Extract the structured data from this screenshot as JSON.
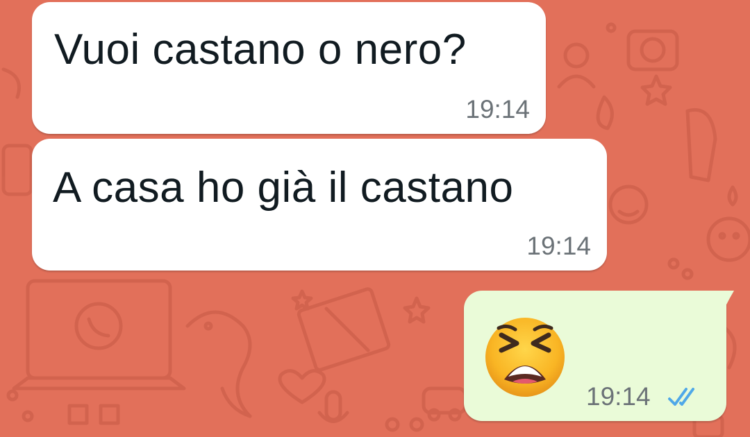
{
  "chat": {
    "messages": [
      {
        "direction": "incoming",
        "text": "Vuoi castano o nero?",
        "time": "19:14"
      },
      {
        "direction": "incoming",
        "text": "A casa ho già il castano",
        "time": "19:14"
      },
      {
        "direction": "outgoing",
        "emoji": "tired-face-emoji",
        "time": "19:14",
        "status": "read-double-check-icon"
      }
    ]
  },
  "colors": {
    "wallpaper": "#E2705A",
    "incoming_bubble": "#FFFFFF",
    "outgoing_bubble": "#EAFBD8",
    "read_ticks": "#4FA8E8",
    "timestamp": "#6B7277",
    "text": "#111B21"
  }
}
